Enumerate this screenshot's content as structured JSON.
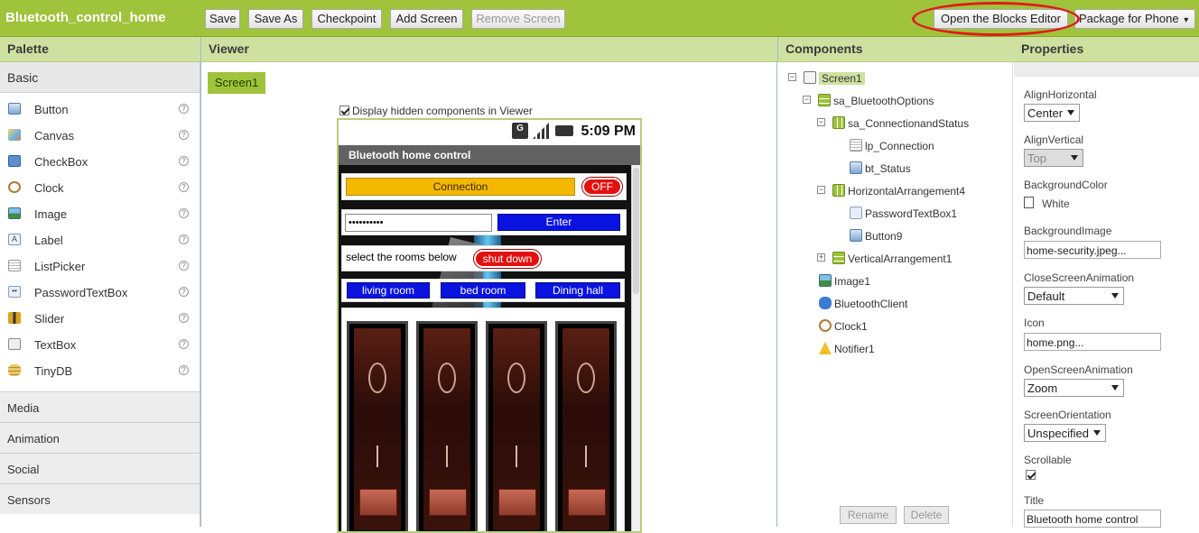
{
  "app": {
    "title": "Bluetooth_control_home"
  },
  "toolbar": {
    "save": "Save",
    "save_as": "Save As",
    "checkpoint": "Checkpoint",
    "add_screen": "Add Screen",
    "remove_screen": "Remove Screen",
    "blocks_editor": "Open the Blocks Editor",
    "package": "Package for Phone",
    "package_arrow": "▾"
  },
  "headers": {
    "palette": "Palette",
    "viewer": "Viewer",
    "components": "Components",
    "properties": "Properties"
  },
  "palette": {
    "active_section": "Basic",
    "help_glyph": "?",
    "items": [
      {
        "label": "Button",
        "icon": "button-icon"
      },
      {
        "label": "Canvas",
        "icon": "canvas-icon"
      },
      {
        "label": "CheckBox",
        "icon": "checkbox-icon"
      },
      {
        "label": "Clock",
        "icon": "clock-icon"
      },
      {
        "label": "Image",
        "icon": "image-icon"
      },
      {
        "label": "Label",
        "icon": "label-icon"
      },
      {
        "label": "ListPicker",
        "icon": "listpicker-icon"
      },
      {
        "label": "PasswordTextBox",
        "icon": "password-icon"
      },
      {
        "label": "Slider",
        "icon": "slider-icon"
      },
      {
        "label": "TextBox",
        "icon": "textbox-icon"
      },
      {
        "label": "TinyDB",
        "icon": "database-icon"
      }
    ],
    "categories": [
      "Media",
      "Animation",
      "Social",
      "Sensors"
    ]
  },
  "viewer": {
    "screen_tab": "Screen1",
    "display_hidden": "Display hidden components in Viewer",
    "display_hidden_checked": true,
    "phone": {
      "clock": "5:09 PM",
      "network_letter": "G",
      "title": "Bluetooth home control",
      "connection_button": "Connection",
      "status_pill": "OFF",
      "password_value": "••••••••••",
      "enter_button": "Enter",
      "rooms_label": "select the rooms below",
      "shutdown_button": "shut down",
      "room_buttons": [
        "living room",
        "bed room",
        "Dining hall"
      ],
      "slider_count": 4
    }
  },
  "components": {
    "rename": "Rename",
    "delete": "Delete",
    "tree": [
      {
        "label": "Screen1",
        "level": 0,
        "toggle": "⊟",
        "icon": "screen-icon",
        "selected": true
      },
      {
        "label": "sa_BluetoothOptions",
        "level": 1,
        "toggle": "⊟",
        "icon": "vertical-arrangement-icon"
      },
      {
        "label": "sa_ConnectionandStatus",
        "level": 2,
        "toggle": "⊟",
        "icon": "horizontal-arrangement-icon"
      },
      {
        "label": "lp_Connection",
        "level": 3,
        "toggle": "",
        "icon": "listpicker-icon"
      },
      {
        "label": "bt_Status",
        "level": 3,
        "toggle": "",
        "icon": "button-icon"
      },
      {
        "label": "HorizontalArrangement4",
        "level": 2,
        "toggle": "⊟",
        "icon": "horizontal-arrangement-icon"
      },
      {
        "label": "PasswordTextBox1",
        "level": 3,
        "toggle": "",
        "icon": "password-icon"
      },
      {
        "label": "Button9",
        "level": 3,
        "toggle": "",
        "icon": "button-icon"
      },
      {
        "label": "VerticalArrangement1",
        "level": 2,
        "toggle": "⊞",
        "icon": "vertical-arrangement-icon"
      },
      {
        "label": "Image1",
        "level": 2,
        "toggle": "",
        "icon": "image-icon"
      },
      {
        "label": "BluetoothClient",
        "level": 2,
        "toggle": "",
        "icon": "bluetooth-icon"
      },
      {
        "label": "Clock1",
        "level": 2,
        "toggle": "",
        "icon": "clock-icon"
      },
      {
        "label": "Notifier1",
        "level": 2,
        "toggle": "",
        "icon": "warning-icon"
      }
    ]
  },
  "properties": {
    "align_horizontal": {
      "label": "AlignHorizontal",
      "value": "Center"
    },
    "align_vertical": {
      "label": "AlignVertical",
      "value": "Top"
    },
    "background_color": {
      "label": "BackgroundColor",
      "value": "White"
    },
    "background_image": {
      "label": "BackgroundImage",
      "value": "home-security.jpeg..."
    },
    "close_animation": {
      "label": "CloseScreenAnimation",
      "value": "Default"
    },
    "icon": {
      "label": "Icon",
      "value": "home.png..."
    },
    "open_animation": {
      "label": "OpenScreenAnimation",
      "value": "Zoom"
    },
    "orientation": {
      "label": "ScreenOrientation",
      "value": "Unspecified"
    },
    "scrollable": {
      "label": "Scrollable",
      "checked": true
    },
    "title": {
      "label": "Title",
      "value": "Bluetooth home control"
    }
  },
  "colors": {
    "brand_green": "#9fc33b",
    "header_green": "#cfe1a0",
    "annotation_red": "#e01b1b",
    "connection_yellow": "#f4b800",
    "room_blue": "#0a13e0",
    "alert_red": "#e31010"
  }
}
